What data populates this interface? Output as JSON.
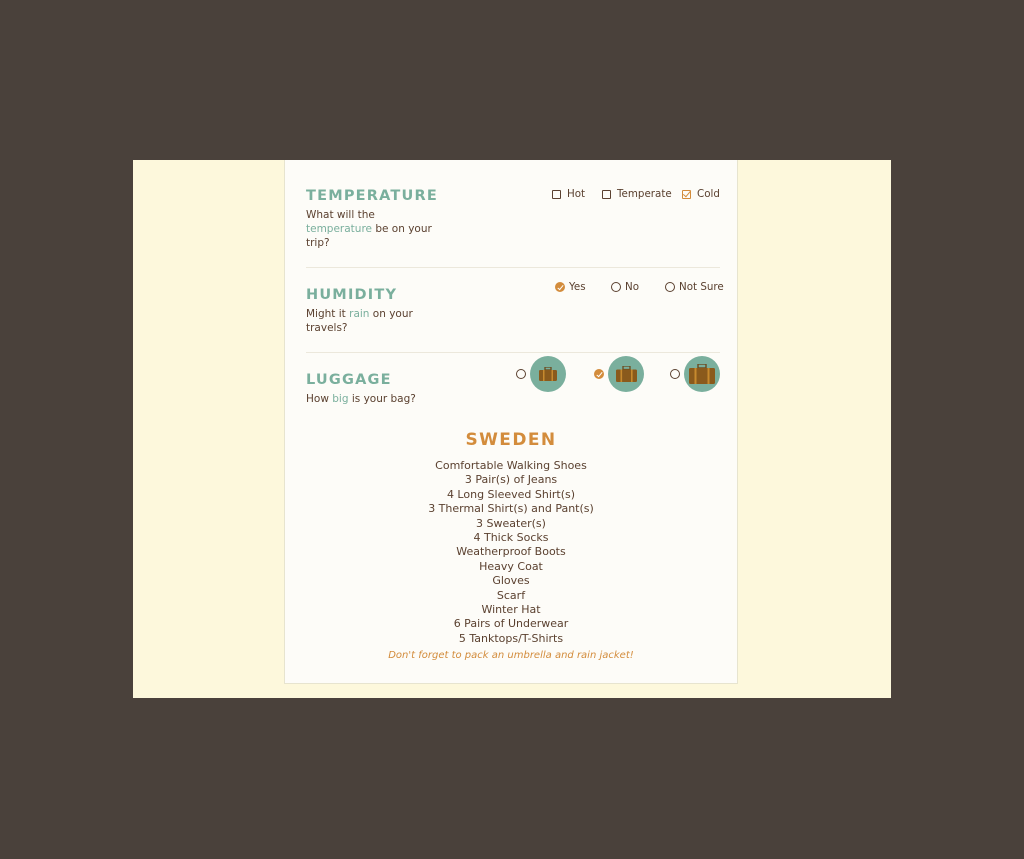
{
  "temperature": {
    "title": "TEMPERATURE",
    "desc_before": "What will the ",
    "desc_highlight": "temperature",
    "desc_after": " be on your trip?",
    "options": [
      {
        "label": "Hot",
        "checked": false
      },
      {
        "label": "Temperate",
        "checked": false
      },
      {
        "label": "Cold",
        "checked": true
      }
    ]
  },
  "humidity": {
    "title": "HUMIDITY",
    "desc_before": "Might it ",
    "desc_highlight": "rain",
    "desc_after": " on your travels?",
    "options": [
      {
        "label": "Yes",
        "checked": true
      },
      {
        "label": "No",
        "checked": false
      },
      {
        "label": "Not Sure",
        "checked": false
      }
    ]
  },
  "luggage": {
    "title": "LUGGAGE",
    "desc_before": "How ",
    "desc_highlight": "big",
    "desc_after": " is your bag?",
    "options": [
      {
        "icon": "small-suitcase-icon",
        "checked": false
      },
      {
        "icon": "medium-suitcase-icon",
        "checked": true
      },
      {
        "icon": "large-suitcase-icon",
        "checked": false
      }
    ]
  },
  "result": {
    "country": "SWEDEN",
    "items": [
      "Comfortable Walking Shoes",
      "3 Pair(s) of Jeans",
      "4 Long Sleeved Shirt(s)",
      "3 Thermal Shirt(s) and Pant(s)",
      "3 Sweater(s)",
      "4 Thick Socks",
      "Weatherproof Boots",
      "Heavy Coat",
      "Gloves",
      "Scarf",
      "Winter Hat",
      "6 Pairs of Underwear",
      "5 Tanktops/T-Shirts"
    ],
    "note": "Don't forget to pack an umbrella and rain jacket!"
  },
  "colors": {
    "accent_teal": "#7aaf9d",
    "accent_orange": "#d38c3c",
    "text_brown": "#5b4130",
    "backdrop": "#4a413b",
    "page_bg": "#fdf8dc"
  }
}
